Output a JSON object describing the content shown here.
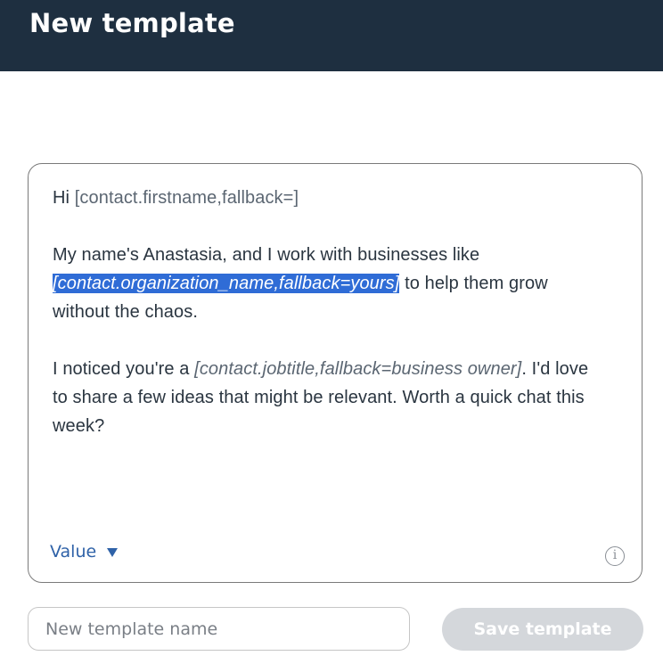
{
  "header": {
    "title": "New template"
  },
  "editor": {
    "line1_prefix": "Hi ",
    "line1_token": "[contact.firstname,fallback=]",
    "para2_line1": "My name's Anastasia, and I work with businesses like",
    "para2_token_selected": "[contact.organization_name,fallback=yours]",
    "para2_line2_suffix": " to help them grow",
    "para2_line3": "without the chaos.",
    "para3_prefix": "I noticed you're a ",
    "para3_token": "[contact.jobtitle,fallback=business owner]",
    "para3_line1_suffix": ". I'd love",
    "para3_line2": "to share a few ideas that might be relevant. Worth a quick chat this",
    "para3_line3": "week?",
    "value_dropdown_label": "Value",
    "info_icon_glyph": "i"
  },
  "footer": {
    "name_placeholder": "New template name",
    "name_value": "",
    "save_label": "Save template"
  },
  "colors": {
    "header_bg": "#1e2f40",
    "selection_bg": "#2f6cd6",
    "link_blue": "#2f62a8",
    "disabled_button_bg": "#d4d7db"
  }
}
